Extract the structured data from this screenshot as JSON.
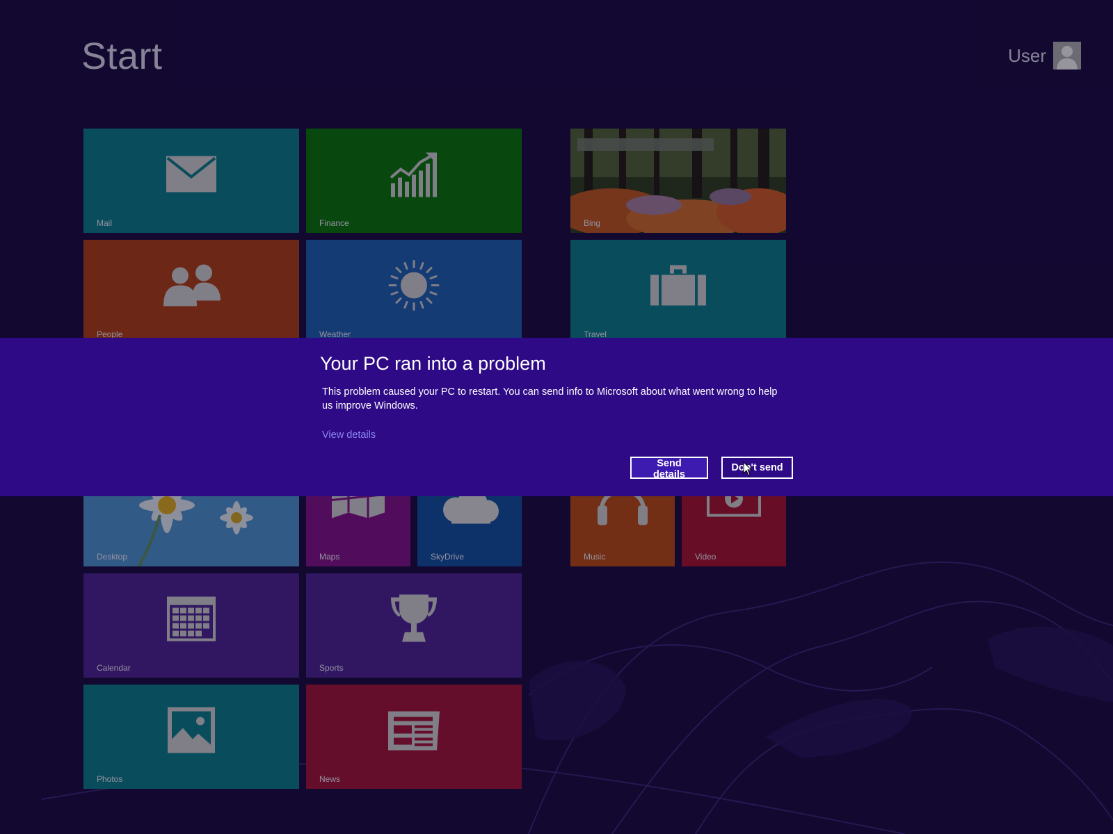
{
  "header": {
    "title": "Start",
    "user_name": "User"
  },
  "tiles": {
    "mail": "Mail",
    "finance": "Finance",
    "bing": "Bing",
    "people": "People",
    "weather": "Weather",
    "travel": "Travel",
    "desktop": "Desktop",
    "maps": "Maps",
    "skydrive": "SkyDrive",
    "music": "Music",
    "video": "Video",
    "calendar": "Calendar",
    "sports": "Sports",
    "photos": "Photos",
    "news": "News"
  },
  "dialog": {
    "title": "Your PC ran into a problem",
    "body": "This problem caused your PC to restart. You can send info to Microsoft about what went wrong to help us improve Windows.",
    "link": "View details",
    "send_button": "Send details",
    "dont_send_button": "Don't send"
  },
  "colors": {
    "background": "#170b3d",
    "dialog_band": "#2e0a86",
    "link": "#8c87f0"
  }
}
